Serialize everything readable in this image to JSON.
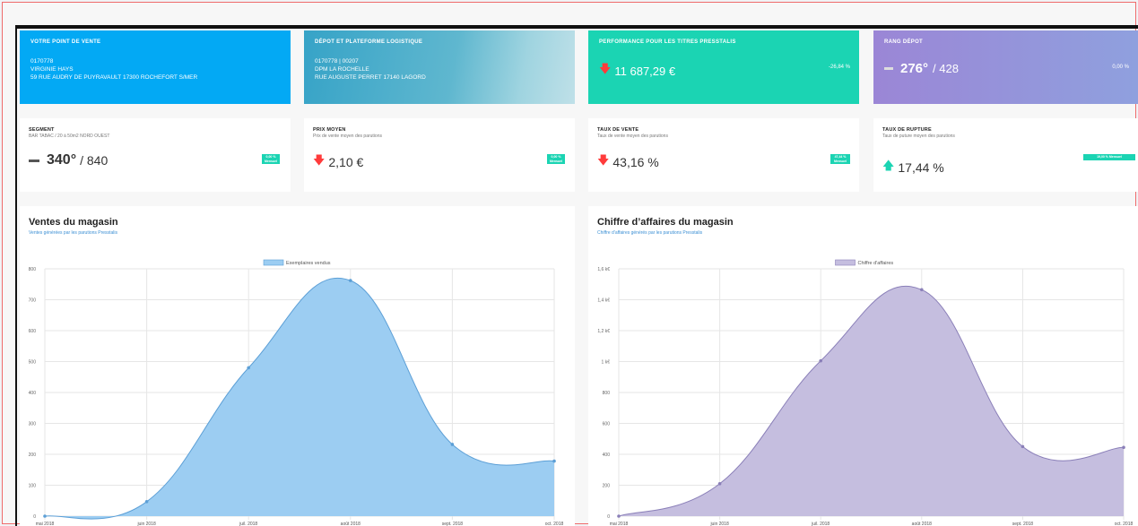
{
  "tiles": {
    "point_de_vente": {
      "title": "VOTRE POINT DE VENTE",
      "line1": "0170778",
      "line2": "VIRGINIE HAYS",
      "line3": "59 RUE AUDRY DE PUYRAVAULT 17300 ROCHEFORT S/MER"
    },
    "depot": {
      "title": "DÉPOT ET PLATEFORME LOGISTIQUE",
      "line1": "0170778 | 00207",
      "line2": "DPM LA ROCHELLE",
      "line3": "RUE AUGUSTE PERRET 17140 LAGORD"
    },
    "performance": {
      "title": "PERFORMANCE POUR LES TITRES PRESSTALIS",
      "value": "11 687,29 €",
      "pct": "-26,84 %"
    },
    "rang": {
      "title": "RANG DÉPOT",
      "rank": "276°",
      "total": "/ 428",
      "pct": "0,00 %"
    }
  },
  "kpis": {
    "segment": {
      "title": "SEGMENT",
      "sub": "BAR TABAC / 20 à 50m2 NORD OUEST",
      "rank": "340°",
      "total": "/ 840",
      "badge": "0,00 % Mensuel"
    },
    "prix": {
      "title": "PRIX MOYEN",
      "sub": "Prix de vente moyen des parutions",
      "value": "2,10 €",
      "badge": "0,00 % Mensuel"
    },
    "taux_vente": {
      "title": "TAUX DE VENTE",
      "sub": "Taux de vente moyen des parutions",
      "value": "43,16 %",
      "badge": "47,44 % Mensuel"
    },
    "taux_rupture": {
      "title": "TAUX DE RUPTURE",
      "sub": "Taux de puture moyen des parutions",
      "value": "17,44 %",
      "badge": "19,00 % Mensuel"
    }
  },
  "colors": {
    "blue": "#03a9f4",
    "teal": "#1bd4b3",
    "purple": "#9b86d6",
    "red": "#ff3b3b"
  },
  "panels": {
    "ventes": {
      "title": "Ventes du magasin",
      "subtitle": "Ventes générées par les parutions Presstalis"
    },
    "ca": {
      "title": "Chiffre d’affaires du magasin",
      "subtitle": "Chiffre d’affaires générés par les parutions Presstalis"
    }
  },
  "chart_data": [
    {
      "type": "area",
      "title": "Ventes du magasin",
      "categories": [
        "mai 2018",
        "juin 2018",
        "juil. 2018",
        "août 2018",
        "sept. 2018",
        "oct. 2018"
      ],
      "series": [
        {
          "name": "Exemplaires vendus",
          "values": [
            0,
            47,
            480,
            762,
            232,
            178
          ]
        }
      ],
      "ylim": [
        0,
        800
      ],
      "yticks": [
        "0",
        "100",
        "200",
        "300",
        "400",
        "500",
        "600",
        "700",
        "800"
      ],
      "grid": true,
      "legend": "top",
      "fill": "#9ccdf2",
      "stroke": "#5c9fd6"
    },
    {
      "type": "area",
      "title": "Chiffre d’affaires du magasin",
      "categories": [
        "mai 2018",
        "juin 2018",
        "juil. 2018",
        "août 2018",
        "sept. 2018",
        "oct. 2018"
      ],
      "series": [
        {
          "name": "Chiffre d'affaires",
          "values": [
            0,
            210,
            1005,
            1465,
            450,
            445
          ]
        }
      ],
      "ylim": [
        0,
        1600
      ],
      "yticks": [
        "0",
        "200",
        "400",
        "600",
        "800",
        "1 k€",
        "1,2 k€",
        "1,4 k€",
        "1,6 k€"
      ],
      "grid": true,
      "legend": "top",
      "fill": "#c5bedf",
      "stroke": "#8a7fb8"
    }
  ]
}
